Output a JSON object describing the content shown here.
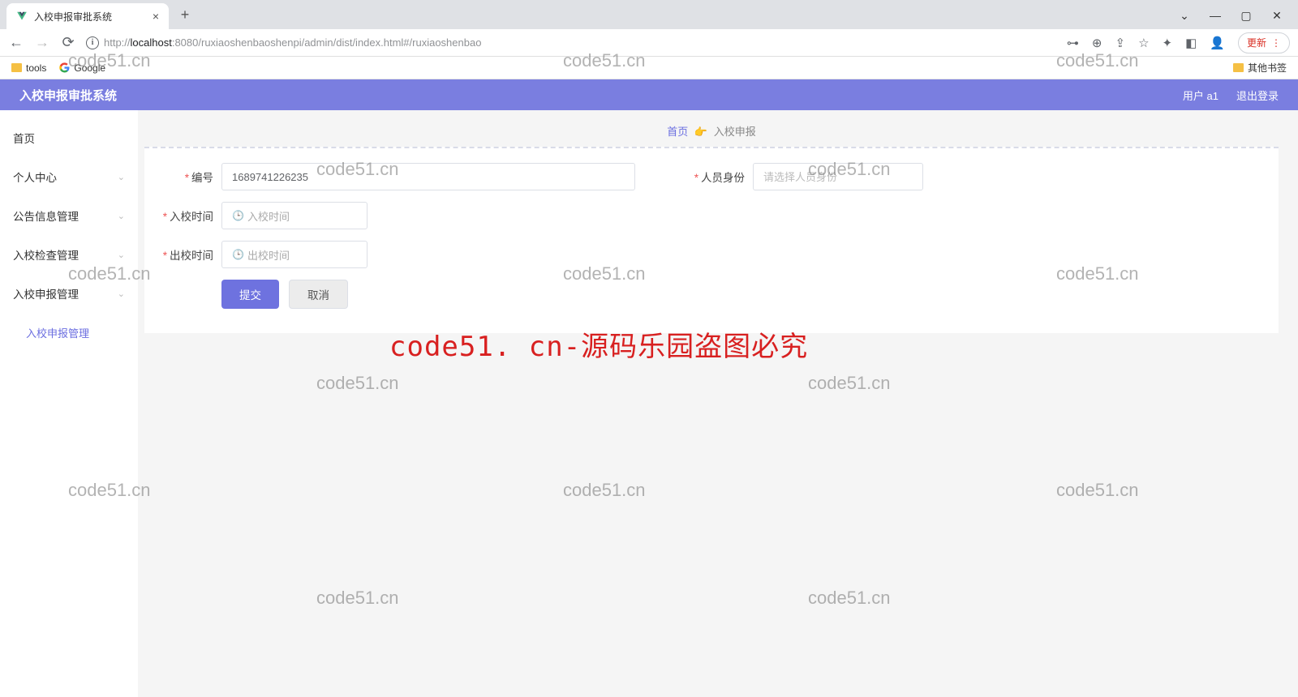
{
  "browser": {
    "tab_title": "入校申报审批系统",
    "url_prefix": "http://",
    "url_host": "localhost",
    "url_path": ":8080/ruxiaoshenbaoshenpi/admin/dist/index.html#/ruxiaoshenbao",
    "update_label": "更新",
    "bookmarks": {
      "tools": "tools",
      "google": "Google",
      "other": "其他书签"
    }
  },
  "header": {
    "title": "入校申报审批系统",
    "user_label": "用户 a1",
    "logout": "退出登录"
  },
  "sidebar": {
    "home": "首页",
    "personal": "个人中心",
    "notice": "公告信息管理",
    "check": "入校检查管理",
    "apply": "入校申报管理",
    "apply_sub": "入校申报管理"
  },
  "breadcrumb": {
    "home": "首页",
    "sep": "👉",
    "current": "入校申报"
  },
  "form": {
    "code_label": "编号",
    "code_value": "1689741226235",
    "identity_label": "人员身份",
    "identity_placeholder": "请选择人员身份",
    "in_time_label": "入校时间",
    "in_time_placeholder": "入校时间",
    "out_time_label": "出校时间",
    "out_time_placeholder": "出校时间",
    "submit": "提交",
    "cancel": "取消"
  },
  "watermark": {
    "text": "code51.cn",
    "red": "code51. cn-源码乐园盗图必究"
  }
}
